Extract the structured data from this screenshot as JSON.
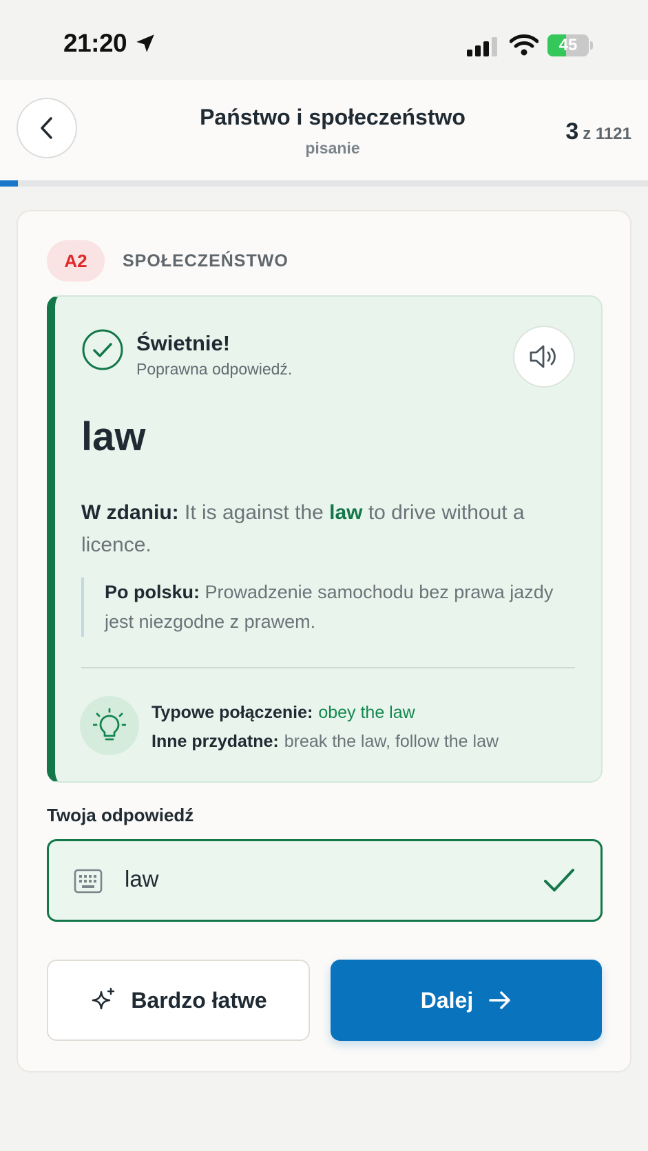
{
  "status_bar": {
    "time": "21:20",
    "battery_percent": "45",
    "battery_level": 0.45
  },
  "header": {
    "title": "Państwo i społeczeństwo",
    "subtitle": "pisanie",
    "counter_current": "3",
    "counter_total": "z 1121",
    "progress_fraction": 0.0027
  },
  "card": {
    "level": "A2",
    "category": "SPOŁECZEŃSTWO",
    "feedback": {
      "title": "Świetnie!",
      "subtitle": "Poprawna odpowiedź.",
      "word": "law",
      "sentence_label": "W zdaniu:",
      "sentence_before": "It is against the",
      "sentence_highlight": "law",
      "sentence_after": "to drive without a licence.",
      "translation_label": "Po polsku:",
      "translation_text": "Prowadzenie samochodu bez prawa jazdy jest niezgodne z prawem.",
      "collocation_label": "Typowe połączenie:",
      "collocation_value": "obey the law",
      "other_label": "Inne przydatne:",
      "other_value": "break the law, follow the law"
    },
    "answer": {
      "label": "Twoja odpowiedź",
      "value": "law"
    },
    "buttons": {
      "easy_label": "Bardzo łatwe",
      "next_label": "Dalej"
    }
  },
  "icons": {
    "status_location": "location-arrow-icon",
    "status_signal": "cellular-signal-icon",
    "status_wifi": "wifi-icon",
    "back": "chevron-left-icon",
    "correct": "check-circle-icon",
    "audio": "speaker-icon",
    "tip": "lightbulb-icon",
    "input": "keyboard-icon",
    "answer_ok": "checkmark-icon",
    "easy": "sparkle-icon",
    "next": "arrow-right-icon"
  },
  "colors": {
    "accent_blue": "#0a73bd",
    "success_green": "#13774a",
    "level_red": "#e0282b",
    "panel_green_bg": "#e9f5ec"
  }
}
